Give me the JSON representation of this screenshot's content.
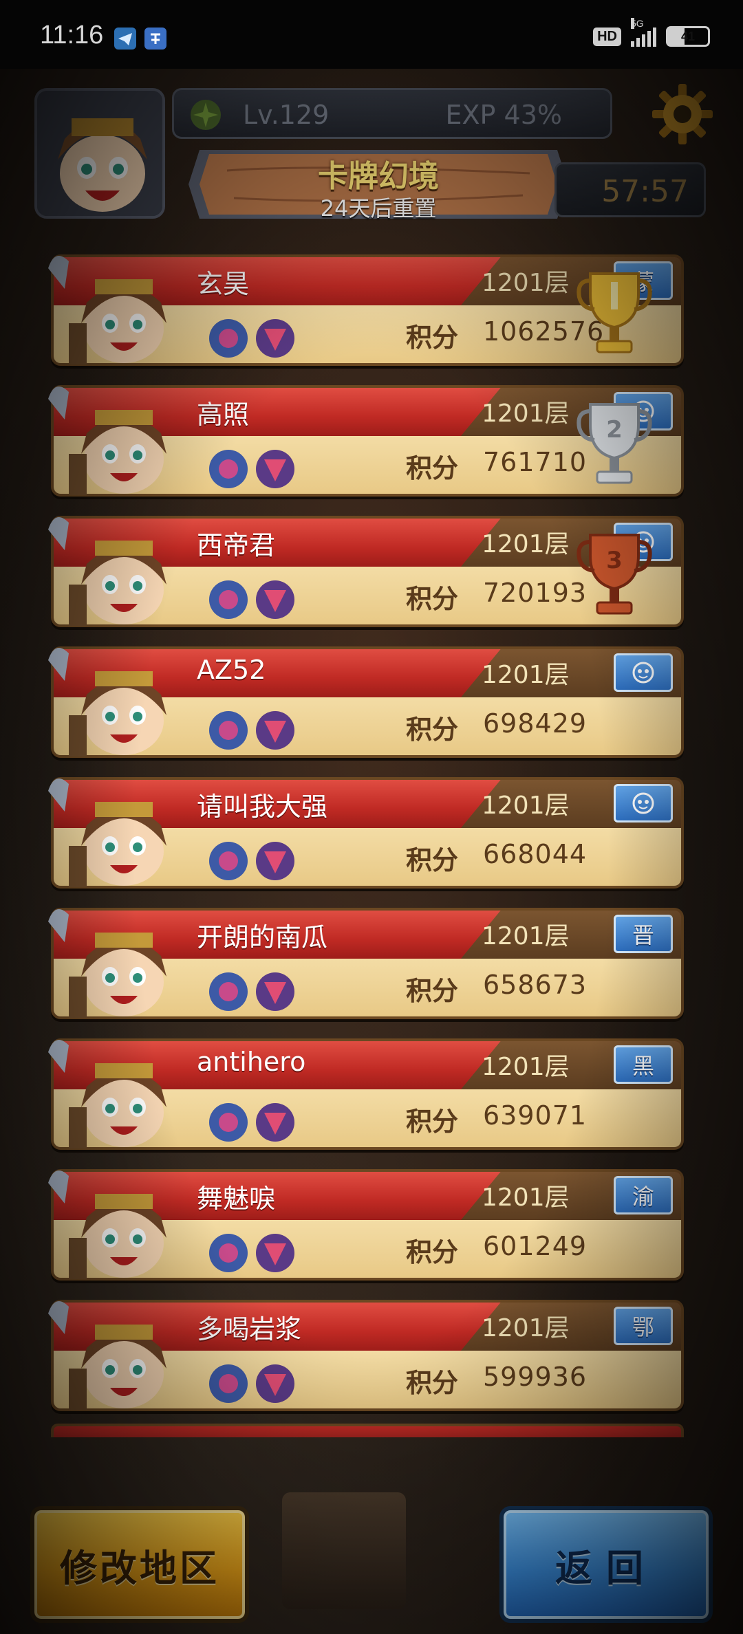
{
  "status_bar": {
    "time": "11:16",
    "hd": "HD",
    "network": "5G",
    "battery": "41",
    "battery_level": 0.41
  },
  "header": {
    "level": "Lv.129",
    "exp": "EXP 43%",
    "title": "卡牌幻境",
    "subtitle": "24天后重置",
    "timer": "57:57"
  },
  "rankings": [
    {
      "name": "玄昊",
      "floor": "1201层",
      "score_label": "积分",
      "score": "1062576",
      "region": "蒙",
      "trophy": "gold"
    },
    {
      "name": "高照",
      "floor": "1201层",
      "score_label": "积分",
      "score": "761710",
      "region": "",
      "region_icon": "face-icon",
      "trophy": "silver"
    },
    {
      "name": "西帝君",
      "floor": "1201层",
      "score_label": "积分",
      "score": "720193",
      "region": "",
      "region_icon": "face-icon",
      "trophy": "bronze"
    },
    {
      "name": "AZ52",
      "floor": "1201层",
      "score_label": "积分",
      "score": "698429",
      "region": "",
      "region_icon": "face-icon"
    },
    {
      "name": "请叫我大强",
      "floor": "1201层",
      "score_label": "积分",
      "score": "668044",
      "region": "",
      "region_icon": "face-icon"
    },
    {
      "name": "开朗的南瓜",
      "floor": "1201层",
      "score_label": "积分",
      "score": "658673",
      "region": "晋"
    },
    {
      "name": "antihero",
      "floor": "1201层",
      "score_label": "积分",
      "score": "639071",
      "region": "黑"
    },
    {
      "name": "舞魅唳",
      "floor": "1201层",
      "score_label": "积分",
      "score": "601249",
      "region": "渝"
    },
    {
      "name": "多喝岩浆",
      "floor": "1201层",
      "score_label": "积分",
      "score": "599936",
      "region": "鄂"
    }
  ],
  "buttons": {
    "change_region": "修改地区",
    "back": "返回"
  },
  "colors": {
    "row_red": "#c02a24",
    "parchment": "#f3dca5",
    "badge_blue": "#2d6fc1",
    "button_gold": "#f2a91a",
    "button_blue": "#3e95e8"
  }
}
